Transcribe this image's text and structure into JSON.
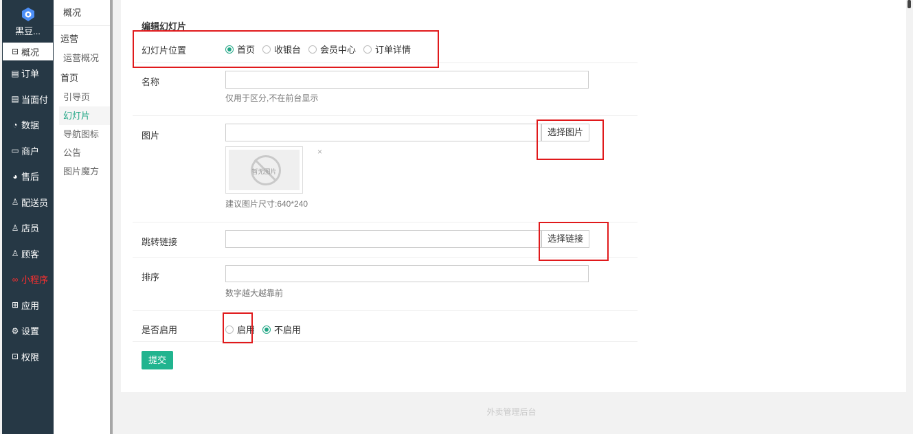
{
  "brand": {
    "name": "黑豆..."
  },
  "sidebar": {
    "items": [
      {
        "label": "概况",
        "icon": "⊟",
        "icon_name": "grid-icon",
        "active": true
      },
      {
        "label": "订单",
        "icon": "▤",
        "icon_name": "list-icon"
      },
      {
        "label": "当面付",
        "icon": "▤",
        "icon_name": "list-icon"
      },
      {
        "label": "数据",
        "icon": "◔",
        "icon_name": "chart-icon"
      },
      {
        "label": "商户",
        "icon": "▭",
        "icon_name": "store-icon"
      },
      {
        "label": "售后",
        "icon": "◕",
        "icon_name": "service-icon"
      },
      {
        "label": "配送员",
        "icon": "♙",
        "icon_name": "courier-icon"
      },
      {
        "label": "店员",
        "icon": "♙",
        "icon_name": "clerk-icon"
      },
      {
        "label": "顾客",
        "icon": "♙",
        "icon_name": "customer-icon"
      },
      {
        "label": "小程序",
        "icon": "∞",
        "icon_name": "miniprogram-icon",
        "highlight": true
      },
      {
        "label": "应用",
        "icon": "⊞",
        "icon_name": "apps-icon"
      },
      {
        "label": "设置",
        "icon": "⚙",
        "icon_name": "gear-icon"
      },
      {
        "label": "权限",
        "icon": "⊡",
        "icon_name": "lock-icon"
      }
    ]
  },
  "subnav": {
    "top": "概况",
    "groups": [
      {
        "label": "运营",
        "items": [
          "运营概况"
        ]
      },
      {
        "label": "首页",
        "items": [
          "引导页",
          "幻灯片",
          "导航图标",
          "公告",
          "图片魔方"
        ]
      }
    ],
    "active_item": "幻灯片"
  },
  "form": {
    "title": "编辑幻灯片",
    "position": {
      "label": "幻灯片位置",
      "options": [
        "首页",
        "收银台",
        "会员中心",
        "订单详情"
      ],
      "selected": "首页"
    },
    "name": {
      "label": "名称",
      "value": "",
      "hint": "仅用于区分,不在前台显示"
    },
    "image": {
      "label": "图片",
      "value": "",
      "button": "选择图片",
      "placeholder_text": "暂无图片",
      "close": "×",
      "hint": "建议图片尺寸:640*240"
    },
    "link": {
      "label": "跳转链接",
      "value": "",
      "button": "选择链接"
    },
    "sort": {
      "label": "排序",
      "value": "",
      "hint": "数字越大越靠前"
    },
    "enabled": {
      "label": "是否启用",
      "options": [
        "启用",
        "不启用"
      ],
      "selected": "不启用"
    },
    "submit": "提交"
  },
  "footer": {
    "text": "外卖管理后台"
  },
  "colors": {
    "accent": "#21a685",
    "sidebar_bg": "#263845",
    "annotation": "#e0191b",
    "submit_bg": "#21b48f"
  }
}
